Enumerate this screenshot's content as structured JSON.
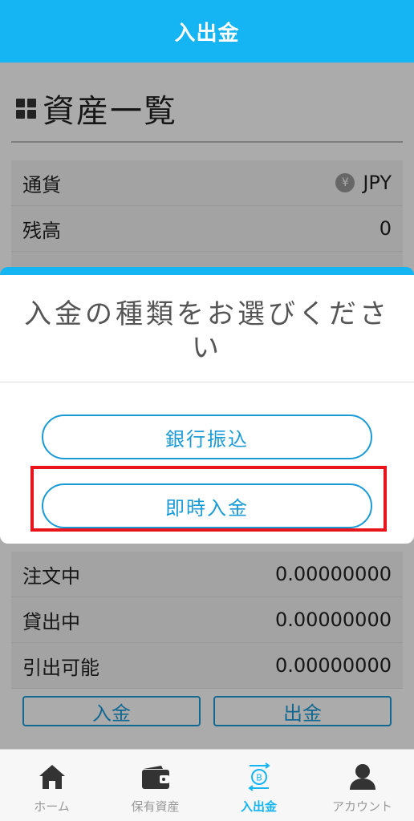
{
  "header": {
    "title": "入出金"
  },
  "assets": {
    "title": "資産一覧",
    "rows": [
      {
        "label": "通貨",
        "value": "JPY",
        "currency_symbol": "¥"
      },
      {
        "label": "残高",
        "value": "0"
      }
    ],
    "lower_rows": [
      {
        "label": "注文中",
        "value": "0.00000000"
      },
      {
        "label": "貸出中",
        "value": "0.00000000"
      },
      {
        "label": "引出可能",
        "value": "0.00000000"
      }
    ],
    "deposit_label": "入金",
    "withdraw_label": "出金"
  },
  "modal": {
    "title": "入金の種類をお選びください",
    "options": [
      {
        "label": "銀行振込"
      },
      {
        "label": "即時入金"
      }
    ],
    "highlight_color": "#e8141c"
  },
  "nav": {
    "items": [
      {
        "label": "ホーム",
        "icon": "home-icon"
      },
      {
        "label": "保有資産",
        "icon": "wallet-icon"
      },
      {
        "label": "入出金",
        "icon": "deposit-withdraw-icon",
        "active": true
      },
      {
        "label": "アカウント",
        "icon": "account-icon"
      }
    ]
  },
  "colors": {
    "brand": "#15b5f3",
    "button_border": "#1a9bd7",
    "highlight": "#e8141c"
  }
}
